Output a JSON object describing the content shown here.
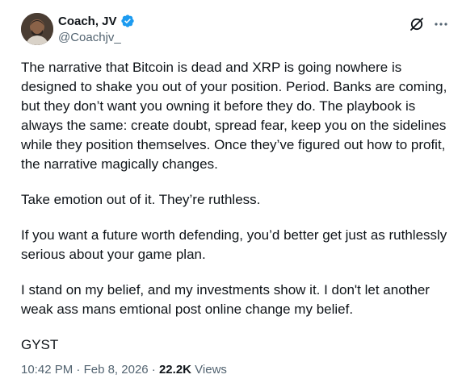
{
  "author": {
    "display_name": "Coach, JV",
    "handle": "@Coachjv_",
    "verified": true
  },
  "icons": {
    "verified": "verified-badge-icon",
    "grok": "grok-icon",
    "more": "more-options-icon"
  },
  "post": {
    "paragraphs": [
      "The narrative that Bitcoin is dead and XRP is going nowhere is designed to shake you out of your position. Period. Banks are coming, but they don’t want you owning it before they do. The playbook is always the same: create doubt, spread fear, keep you on the sidelines while they position themselves. Once they’ve figured out how to profit, the narrative magically changes.",
      "Take emotion out of it. They’re ruthless.",
      "If you want a future worth defending, you’d better get just as ruthlessly serious about your game plan.",
      "I stand on my belief, and my investments show it. I don't let another weak ass mans emtional post online change my belief.",
      "GYST"
    ]
  },
  "meta": {
    "time": "10:42 PM",
    "sep1": " · ",
    "date": "Feb 8, 2026",
    "sep2": " · ",
    "views_count": "22.2K",
    "views_label": " Views"
  },
  "colors": {
    "text": "#0f1419",
    "secondary": "#536471",
    "verified_blue": "#1d9bf0"
  }
}
